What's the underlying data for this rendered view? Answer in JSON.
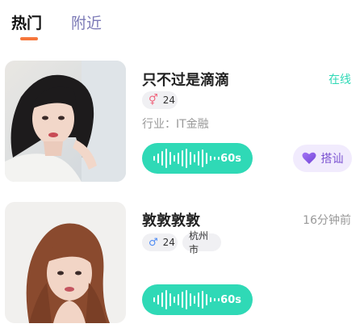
{
  "tabs": {
    "hot": "热门",
    "nearby": "附近"
  },
  "colors": {
    "accent": "#f6763b",
    "voice": "#2fd9b6",
    "online": "#2fd9b6",
    "greet_text": "#7a51d1"
  },
  "users": [
    {
      "name": "只不过是滴滴",
      "status": "在线",
      "gender_icon": "female-icon",
      "age": "24",
      "industry": "行业：IT金融",
      "voice_duration": "60s",
      "greet_label": "搭讪"
    },
    {
      "name": "敦敦敦敦",
      "status": "16分钟前",
      "gender_icon": "male-icon",
      "age": "24",
      "city": "杭州市",
      "voice_duration": "60s"
    }
  ]
}
